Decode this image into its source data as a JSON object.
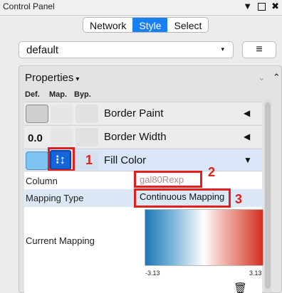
{
  "window": {
    "title": "Control Panel",
    "controls": {
      "dropdown": "▼",
      "maximize": "",
      "close": "✖"
    }
  },
  "tabs": [
    {
      "label": "Network",
      "active": false
    },
    {
      "label": "Style",
      "active": true
    },
    {
      "label": "Select",
      "active": false
    }
  ],
  "style_selector": {
    "value": "default",
    "caret": "▾",
    "menu_icon": "≡"
  },
  "properties": {
    "header": "Properties",
    "header_caret": "▾",
    "collapse_all": "⌄",
    "expand_all": "⌃",
    "columns": {
      "def": "Def.",
      "map": "Map.",
      "byp": "Byp."
    },
    "rows": [
      {
        "label": "Border Paint",
        "default_value": "",
        "expand": "◀"
      },
      {
        "label": "Border Width",
        "default_value": "0.0",
        "expand": "◀"
      },
      {
        "label": "Fill Color",
        "default_value": "",
        "expand": "▼"
      }
    ],
    "fill_detail": {
      "column_label": "Column",
      "column_value": "gal80Rexp",
      "mapping_type_label": "Mapping Type",
      "mapping_type_value": "Continuous Mapping",
      "current_mapping_label": "Current Mapping",
      "range_min": "-3.13",
      "range_max": "3.13",
      "gradient_colors": [
        "#1f77b4",
        "#ffffff",
        "#d32f24"
      ]
    }
  },
  "annotations": {
    "callout_1": "1",
    "callout_2": "2",
    "callout_3": "3",
    "color": "#e0201c"
  },
  "colors": {
    "accent": "#1a7ef5",
    "fill_swatch": "#7dc4f3",
    "mapping_button": "#1565d8"
  }
}
